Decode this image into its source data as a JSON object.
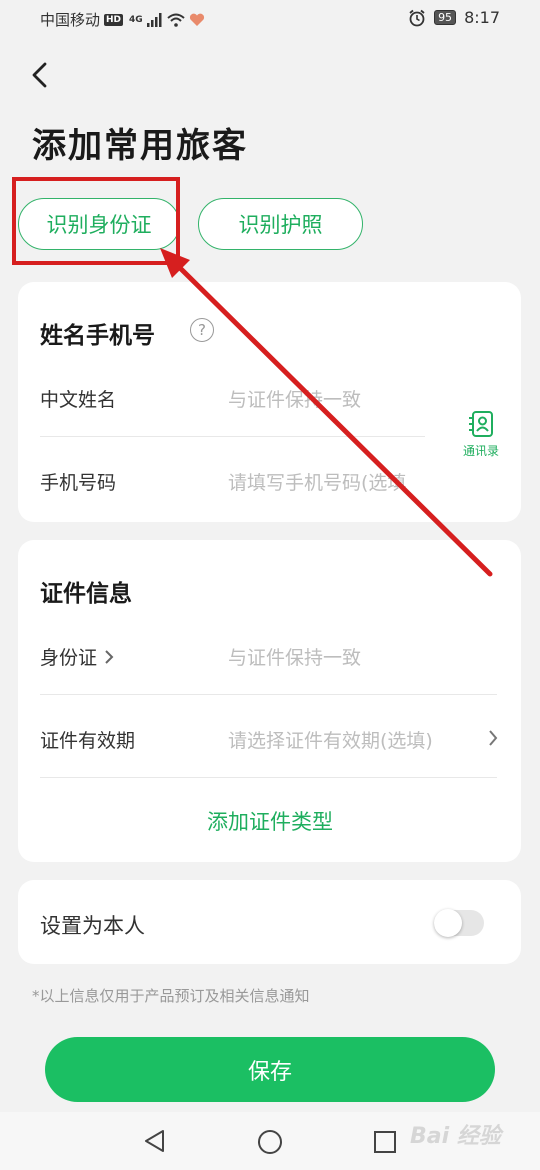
{
  "status_bar": {
    "carrier": "中国移动",
    "hd": "HD",
    "network": "4G",
    "battery": "95",
    "time": "8:17"
  },
  "header": {
    "title": "添加常用旅客"
  },
  "scan_buttons": {
    "id_card": "识别身份证",
    "passport": "识别护照"
  },
  "name_phone_section": {
    "title": "姓名手机号",
    "help_icon": "?",
    "name_label": "中文姓名",
    "name_placeholder": "与证件保持一致",
    "phone_label": "手机号码",
    "phone_placeholder": "请填写手机号码(选填",
    "contacts_label": "通讯录"
  },
  "document_section": {
    "title": "证件信息",
    "doc_type_label": "身份证",
    "doc_number_placeholder": "与证件保持一致",
    "expiry_label": "证件有效期",
    "expiry_placeholder": "请选择证件有效期(选填)",
    "add_doc_type": "添加证件类型"
  },
  "self_section": {
    "label": "设置为本人",
    "toggle_on": false
  },
  "note": "*以上信息仅用于产品预订及相关信息通知",
  "save_button": "保存",
  "watermark": "Bai 经验",
  "colors": {
    "accent": "#1bbf63",
    "annotation_red": "#d61f1f",
    "background": "#f2f2f2"
  },
  "icons": [
    "back-arrow-icon",
    "help-icon",
    "contacts-icon",
    "chevron-right-icon",
    "nav-back-icon",
    "nav-home-icon",
    "nav-recents-icon"
  ]
}
